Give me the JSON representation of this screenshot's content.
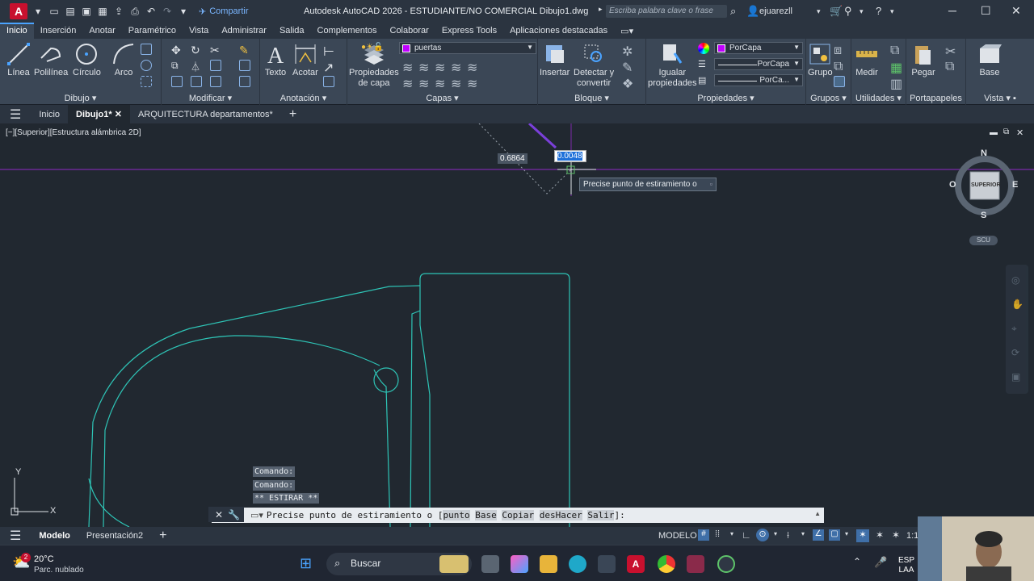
{
  "titlebar": {
    "app_logo": "A",
    "share_label": "Compartir",
    "title": "Autodesk AutoCAD 2026 - ESTUDIANTE/NO COMERCIAL   Dibujo1.dwg",
    "search_placeholder": "Escriba palabra clave o frase",
    "user": "ejuarezll"
  },
  "ribbon_tabs": [
    "Inicio",
    "Inserción",
    "Anotar",
    "Paramétrico",
    "Vista",
    "Administrar",
    "Salida",
    "Complementos",
    "Colaborar",
    "Express Tools",
    "Aplicaciones destacadas"
  ],
  "ribbon": {
    "dibujo": {
      "title": "Dibujo",
      "linea": "Línea",
      "polilinea": "Polilínea",
      "circulo": "Círculo",
      "arco": "Arco"
    },
    "modificar": {
      "title": "Modificar"
    },
    "anotacion": {
      "title": "Anotación",
      "texto": "Texto",
      "acotar": "Acotar"
    },
    "capas": {
      "title": "Capas",
      "propiedades": "Propiedades\nde capa",
      "layer_name": "puertas"
    },
    "bloque": {
      "title": "Bloque",
      "insertar": "Insertar",
      "detectar": "Detectar y\nconvertir"
    },
    "propiedades": {
      "title": "Propiedades",
      "igualar": "Igualar\npropiedades",
      "color": "PorCapa",
      "linetype": "PorCapa",
      "lineweight": "PorCa..."
    },
    "grupos": {
      "title": "Grupos",
      "grupo": "Grupo"
    },
    "utilidades": {
      "title": "Utilidades",
      "medir": "Medir"
    },
    "portapapeles": {
      "title": "Portapapeles",
      "pegar": "Pegar"
    },
    "vista": {
      "title": "Vista",
      "base": "Base"
    }
  },
  "doc_tabs": [
    "Inicio",
    "Dibujo1*",
    "ARQUITECTURA departamentos*"
  ],
  "viewport": {
    "label": "[−][Superior][Estructura alámbrica 2D]",
    "dyn_length": "0.6864",
    "dyn_angle": "0.0048",
    "tooltip": "Precise punto de estiramiento o"
  },
  "viewcube": {
    "n": "N",
    "s": "S",
    "e": "E",
    "o": "O",
    "face": "SUPERIOR",
    "ucs": "SCU"
  },
  "command": {
    "history": [
      "Comando:",
      "Comando:",
      "** ESTIRAR **"
    ],
    "prompt_prefix": "Precise punto de estiramiento o [",
    "options": [
      "punto",
      "Base",
      "Copiar",
      "desHacer",
      "Salir"
    ],
    "prompt_suffix": "]:"
  },
  "layout_tabs": [
    "Modelo",
    "Presentación2"
  ],
  "status": {
    "space": "MODELO",
    "scale": "1:1"
  },
  "taskbar": {
    "temp": "20°C",
    "weather": "Parc. nublado",
    "weather_badge": "2",
    "search": "Buscar",
    "lang1": "ESP",
    "lang2": "LAA"
  },
  "colors": {
    "accent": "#4aa3ff",
    "geometry": "#2ec4b6",
    "crosshair": "#9b30d9",
    "autocad_red": "#c8102e"
  }
}
